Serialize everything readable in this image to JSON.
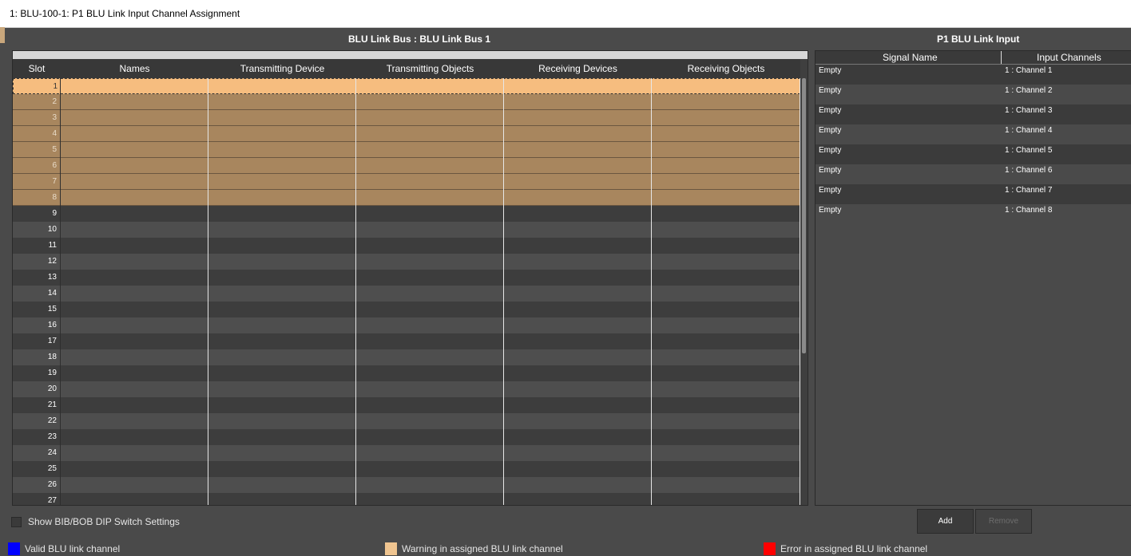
{
  "window": {
    "title": "1: BLU-100-1: P1 BLU Link Input Channel Assignment"
  },
  "bus_panel": {
    "title": "BLU Link Bus : BLU Link Bus 1",
    "columns": [
      "Slot",
      "Names",
      "Transmitting Device",
      "Transmitting Objects",
      "Receiving Devices",
      "Receiving Objects"
    ],
    "rows": [
      {
        "slot": "1",
        "state": "selected"
      },
      {
        "slot": "2",
        "state": "warning"
      },
      {
        "slot": "3",
        "state": "warning"
      },
      {
        "slot": "4",
        "state": "warning"
      },
      {
        "slot": "5",
        "state": "warning"
      },
      {
        "slot": "6",
        "state": "warning"
      },
      {
        "slot": "7",
        "state": "warning"
      },
      {
        "slot": "8",
        "state": "warning"
      },
      {
        "slot": "9",
        "state": "normal"
      },
      {
        "slot": "10",
        "state": "normal"
      },
      {
        "slot": "11",
        "state": "normal"
      },
      {
        "slot": "12",
        "state": "normal"
      },
      {
        "slot": "13",
        "state": "normal"
      },
      {
        "slot": "14",
        "state": "normal"
      },
      {
        "slot": "15",
        "state": "normal"
      },
      {
        "slot": "16",
        "state": "normal"
      },
      {
        "slot": "17",
        "state": "normal"
      },
      {
        "slot": "18",
        "state": "normal"
      },
      {
        "slot": "19",
        "state": "normal"
      },
      {
        "slot": "20",
        "state": "normal"
      },
      {
        "slot": "21",
        "state": "normal"
      },
      {
        "slot": "22",
        "state": "normal"
      },
      {
        "slot": "23",
        "state": "normal"
      },
      {
        "slot": "24",
        "state": "normal"
      },
      {
        "slot": "25",
        "state": "normal"
      },
      {
        "slot": "26",
        "state": "normal"
      },
      {
        "slot": "27",
        "state": "normal"
      }
    ]
  },
  "input_panel": {
    "title": "P1 BLU Link Input",
    "columns": [
      "Signal Name",
      "Input Channels"
    ],
    "rows": [
      {
        "signal": "Empty",
        "channel": "1 : Channel 1"
      },
      {
        "signal": "Empty",
        "channel": "1 : Channel 2"
      },
      {
        "signal": "Empty",
        "channel": "1 : Channel 3"
      },
      {
        "signal": "Empty",
        "channel": "1 : Channel 4"
      },
      {
        "signal": "Empty",
        "channel": "1 : Channel 5"
      },
      {
        "signal": "Empty",
        "channel": "1 : Channel 6"
      },
      {
        "signal": "Empty",
        "channel": "1 : Channel 7"
      },
      {
        "signal": "Empty",
        "channel": "1 : Channel 8"
      }
    ]
  },
  "options": {
    "show_dip_label": "Show BIB/BOB DIP Switch Settings",
    "show_dip_checked": false
  },
  "buttons": {
    "add": "Add",
    "remove": "Remove"
  },
  "legend": [
    {
      "label": "Valid BLU link channel",
      "color": "#0000ff"
    },
    {
      "label": "Warning in assigned BLU link channel",
      "color": "#f0c590"
    },
    {
      "label": "Error in assigned BLU link channel",
      "color": "#ff0000"
    }
  ]
}
